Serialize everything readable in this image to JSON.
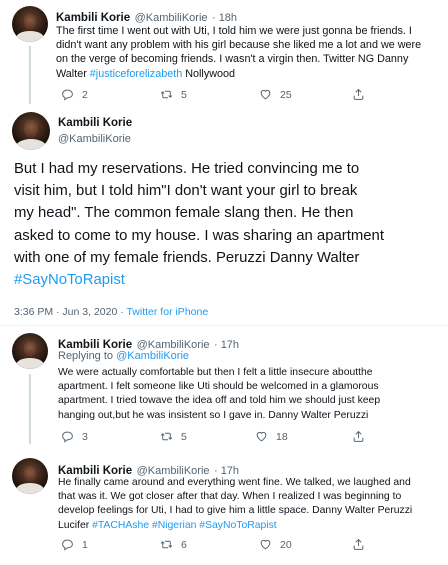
{
  "tweet1": {
    "name": "Kambili Korie",
    "handle": "@KambiliKorie",
    "time": "· 18h",
    "lines": [
      "The first time I went out with Uti, I told him we were just gonna be friends. I",
      "didn't want any problem with his girl because she liked me a lot and we were",
      "on the verge of becoming friends. I wasn't a virgin then. Twitter NG Danny"
    ],
    "line4_plain": "Walter ",
    "line4_hashtag": "#justiceforelizabeth",
    "line4_tail": " Nollywood",
    "replies": "2",
    "retweets": "5",
    "likes": "25"
  },
  "main_tweet": {
    "name": "Kambili Korie",
    "handle": "@KambiliKorie",
    "lines": [
      "But I had my reservations. He tried convincing me to",
      "visit him, but I told him\"I don't want your girl to break",
      "my head\". The common female slang then. He then",
      "asked to come to my house. I was sharing an apartment",
      "with one of my female friends. Peruzzi Danny Walter"
    ],
    "hashtag": "#SayNoToRapist",
    "timestamp": "3:36 PM · Jun 3, 2020 · ",
    "source": "Twitter for iPhone"
  },
  "reply1": {
    "name": "Kambili Korie",
    "handle": "@KambiliKorie",
    "time": "· 17h",
    "replying_prefix": "Replying to ",
    "replying_handle": "@KambiliKorie",
    "lines": [
      "We were actually comfortable but then I felt a little insecure aboutthe",
      "apartment. I felt someone like Uti should be welcomed in a glamorous",
      "apartment. I tried towave the idea off and told him we should just keep",
      "hanging out,but he was insistent so I gave in. Danny Walter Peruzzi"
    ],
    "replies": "3",
    "retweets": "5",
    "likes": "18"
  },
  "reply2": {
    "name": "Kambili Korie",
    "handle": "@KambiliKorie",
    "time": "· 17h",
    "lines": [
      "He finally came around and everything went fine. We talked, we laughed and",
      "that was it. We got closer after that day. When I realized I was beginning to",
      "develop feelings for Uti, I had to give him a little space. Danny Walter Peruzzi"
    ],
    "line4_plain": "Lucifer ",
    "line4_hashtags": "#TACHAshe #Nigerian #SayNoToRapist",
    "replies": "1",
    "retweets": "6",
    "likes": "20"
  },
  "icons": {
    "reply": "reply-icon",
    "retweet": "retweet-icon",
    "like": "heart-icon",
    "share": "share-icon"
  },
  "colors": {
    "link": "#1d9bf0",
    "secondary_text": "#536471",
    "thread_line": "#cfd9de"
  }
}
